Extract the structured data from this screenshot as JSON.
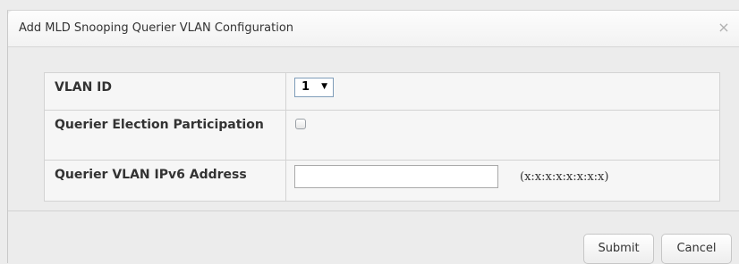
{
  "dialog": {
    "title": "Add MLD Snooping Querier VLAN Configuration",
    "close_icon": "close-icon",
    "close_glyph": "×"
  },
  "form": {
    "vlan_id": {
      "label": "VLAN ID",
      "selected": "1",
      "arrow_glyph": "▼"
    },
    "election": {
      "label": "Querier Election Participation",
      "checked": false
    },
    "ipv6": {
      "label": "Querier VLAN IPv6 Address",
      "value": "",
      "hint": "(x:x:x:x:x:x:x:x)"
    }
  },
  "buttons": {
    "submit": "Submit",
    "cancel": "Cancel"
  },
  "colors": {
    "background": "#ececec",
    "cell_background": "#f6f6f6",
    "border": "#d3d3d3",
    "text": "#333333"
  }
}
